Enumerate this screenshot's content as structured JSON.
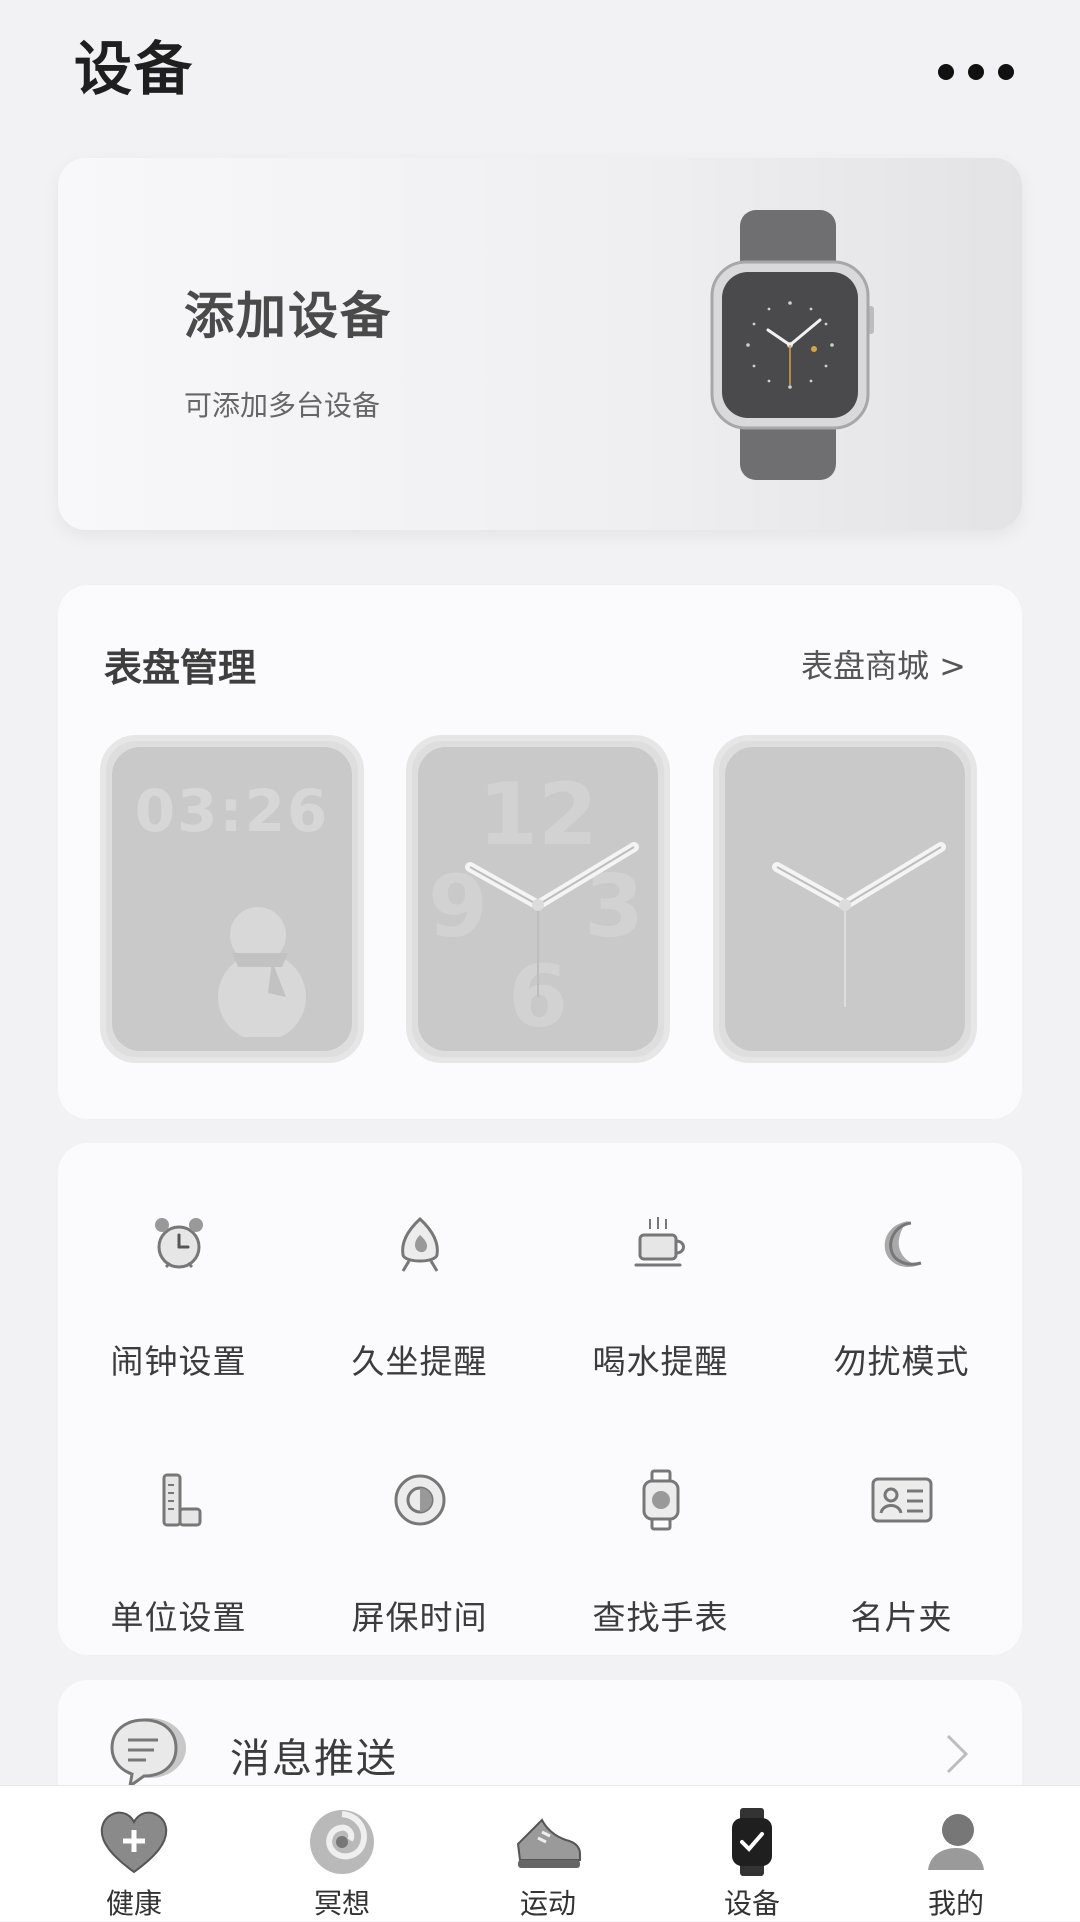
{
  "header": {
    "title": "设备",
    "more_icon": "more-dots-icon"
  },
  "add_device": {
    "title": "添加设备",
    "subtitle": "可添加多台设备",
    "image": "smartwatch-image"
  },
  "watch_faces": {
    "title": "表盘管理",
    "store_link": "表盘商城 >",
    "faces": [
      {
        "name": "digital-snowman-face",
        "time": "03:26"
      },
      {
        "name": "analog-numerals-face",
        "numerals": [
          "12",
          "3",
          "6",
          "9"
        ]
      },
      {
        "name": "analog-minimal-face"
      }
    ]
  },
  "functions": [
    {
      "label": "闹钟设置",
      "icon": "alarm-clock-icon"
    },
    {
      "label": "久坐提醒",
      "icon": "sedentary-reminder-icon"
    },
    {
      "label": "喝水提醒",
      "icon": "coffee-cup-icon"
    },
    {
      "label": "勿扰模式",
      "icon": "moon-icon"
    },
    {
      "label": "单位设置",
      "icon": "ruler-icon"
    },
    {
      "label": "屏保时间",
      "icon": "brightness-icon"
    },
    {
      "label": "查找手表",
      "icon": "watch-icon"
    },
    {
      "label": "名片夹",
      "icon": "business-card-icon"
    }
  ],
  "message_push": {
    "label": "消息推送",
    "icon": "chat-bubble-icon"
  },
  "bottom_nav": [
    {
      "label": "健康",
      "icon": "heart-plus-icon"
    },
    {
      "label": "冥想",
      "icon": "swirl-icon"
    },
    {
      "label": "运动",
      "icon": "sneaker-icon"
    },
    {
      "label": "设备",
      "icon": "watch-icon",
      "active": true
    },
    {
      "label": "我的",
      "icon": "user-icon"
    }
  ],
  "colors": {
    "background": "#f2f2f4",
    "card": "#fbfbfd",
    "icon_gray": "#8a8a8a",
    "face_gray": "#c9c9c9"
  }
}
